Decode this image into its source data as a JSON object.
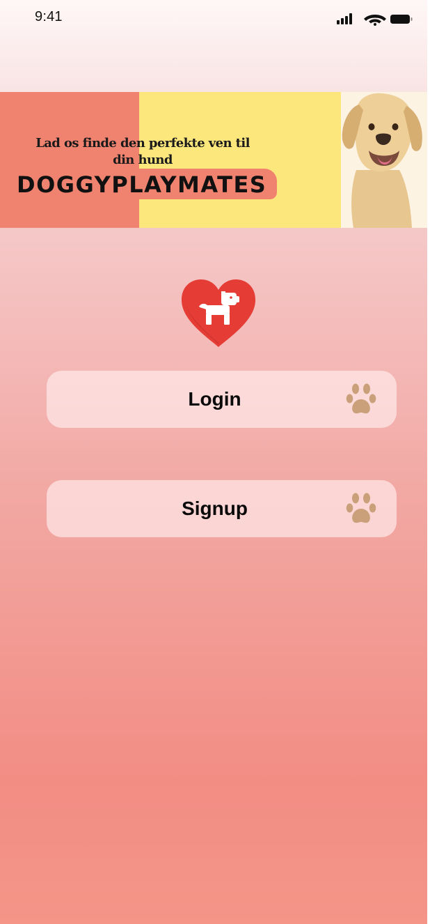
{
  "status_bar": {
    "time": "9:41",
    "icons": [
      "signal-icon",
      "wifi-icon",
      "battery-icon"
    ]
  },
  "banner": {
    "tagline": "Lad os finde den perfekte ven til din hund",
    "brand": "DOGGYPLAYMATES",
    "colors": {
      "left": "#f0836f",
      "middle": "#fce77d",
      "right": "#fdf3e3"
    }
  },
  "logo": {
    "icon": "heart-dog-icon",
    "color": "#e53c35"
  },
  "actions": {
    "login_label": "Login",
    "signup_label": "Signup",
    "icon": "paw-icon",
    "icon_color": "#c9a07a"
  }
}
